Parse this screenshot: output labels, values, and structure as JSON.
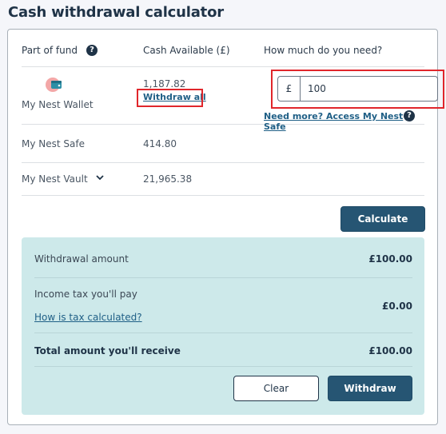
{
  "title": "Cash withdrawal calculator",
  "table": {
    "headers": {
      "part": "Part of fund",
      "cash": "Cash Available (£)",
      "need": "How much do you need?"
    },
    "rows": [
      {
        "name": "My Nest Wallet",
        "amount": "1,187.82",
        "action": "Withdraw all",
        "icon": "wallet-icon"
      },
      {
        "name": "My Nest Safe",
        "amount": "414.80"
      },
      {
        "name": "My Nest Vault",
        "amount": "21,965.38",
        "toggle_icon": "chevron-down-icon"
      }
    ],
    "input": {
      "currency": "£",
      "value": "100"
    },
    "need_more_link": "Need more? Access My Nest Safe",
    "help_glyph": "?"
  },
  "calculate_label": "Calculate",
  "summary": {
    "withdrawal_label": "Withdrawal amount",
    "withdrawal_value": "£100.00",
    "tax_label": "Income tax you'll pay",
    "tax_link": "How is tax calculated?",
    "tax_value": "£0.00",
    "total_label": "Total amount you'll receive",
    "total_value": "£100.00"
  },
  "buttons": {
    "clear": "Clear",
    "withdraw": "Withdraw"
  },
  "colors": {
    "primary": "#265573",
    "summary_bg": "#cde9ea",
    "highlight": "#e0262b",
    "link": "#1f5f86"
  }
}
